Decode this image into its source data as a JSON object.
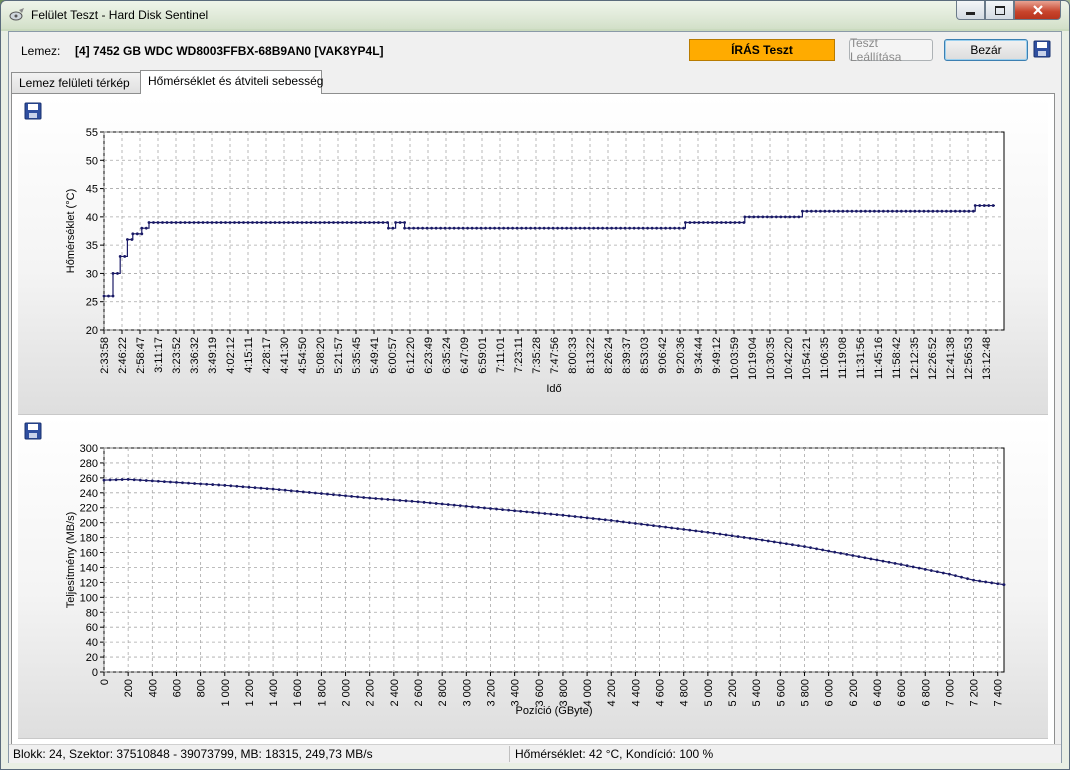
{
  "window": {
    "title": "Felület Teszt - Hard Disk Sentinel",
    "caption_buttons": [
      "minimize-icon",
      "maximize-icon",
      "close-icon"
    ]
  },
  "header": {
    "disk_label": "Lemez:",
    "disk_name": "[4] 7452 GB  WDC WD8003FFBX-68B9AN0 [VAK8YP4L]",
    "status_badge": "ÍRÁS Teszt",
    "stop_button": "Teszt Leállítása",
    "close_button": "Bezár",
    "accent_color": "#ffab00"
  },
  "tabs": [
    {
      "label": "Lemez felületi térkép"
    },
    {
      "label": "Hőmérséklet és átviteli sebesség"
    }
  ],
  "status_bar": {
    "left": "Blokk: 24, Szektor: 37510848 - 39073799, MB: 18315, 249,73 MB/s",
    "right": "Hőmérséklet: 42  °C,  Kondíció: 100 %"
  },
  "chart_data": [
    {
      "type": "line",
      "ylabel": "Hőmérséklet (°C)",
      "xlabel": "Idő",
      "ylim": [
        20,
        55
      ],
      "yticks": [
        20,
        25,
        30,
        35,
        40,
        45,
        50,
        55
      ],
      "grid": true,
      "categories": [
        "2:33:58",
        "2:46:22",
        "2:58:47",
        "3:11:17",
        "3:23:52",
        "3:36:32",
        "3:49:19",
        "4:02:12",
        "4:15:11",
        "4:28:17",
        "4:41:30",
        "4:54:50",
        "5:08:20",
        "5:21:57",
        "5:35:45",
        "5:49:41",
        "6:00:57",
        "6:12:20",
        "6:23:49",
        "6:35:24",
        "6:47:09",
        "6:59:01",
        "7:11:01",
        "7:23:11",
        "7:35:28",
        "7:47:56",
        "8:00:33",
        "8:13:22",
        "8:26:24",
        "8:39:37",
        "8:53:03",
        "9:06:42",
        "9:20:36",
        "9:34:44",
        "9:49:12",
        "10:03:59",
        "10:19:04",
        "10:30:35",
        "10:42:20",
        "10:54:21",
        "11:06:35",
        "11:19:08",
        "11:31:56",
        "11:45:16",
        "11:58:42",
        "12:12:35",
        "12:26:52",
        "12:41:38",
        "12:56:53",
        "13:12:48"
      ],
      "steps": [
        {
          "from": 0.0,
          "to": 0.5,
          "value": 26
        },
        {
          "from": 0.5,
          "to": 0.9,
          "value": 30
        },
        {
          "from": 0.9,
          "to": 1.3,
          "value": 33
        },
        {
          "from": 1.3,
          "to": 1.6,
          "value": 36
        },
        {
          "from": 1.6,
          "to": 2.1,
          "value": 37
        },
        {
          "from": 2.1,
          "to": 2.5,
          "value": 38
        },
        {
          "from": 2.5,
          "to": 15.8,
          "value": 39
        },
        {
          "from": 15.8,
          "to": 16.2,
          "value": 38
        },
        {
          "from": 16.2,
          "to": 16.7,
          "value": 39
        },
        {
          "from": 16.7,
          "to": 32.3,
          "value": 38
        },
        {
          "from": 32.3,
          "to": 35.6,
          "value": 39
        },
        {
          "from": 35.6,
          "to": 38.8,
          "value": 40
        },
        {
          "from": 38.8,
          "to": 48.4,
          "value": 41
        },
        {
          "from": 48.4,
          "to": 49.5,
          "value": 42
        }
      ]
    },
    {
      "type": "line",
      "ylabel": "Teljesítmény (MB/s)",
      "xlabel": "Pozíció (GByte)",
      "xlim": [
        0,
        7452
      ],
      "ylim": [
        0,
        300
      ],
      "yticks": [
        0,
        20,
        40,
        60,
        80,
        100,
        120,
        140,
        160,
        180,
        200,
        220,
        240,
        260,
        280,
        300
      ],
      "xticks": [
        "0",
        "200",
        "400",
        "600",
        "800",
        "1 000",
        "1 200",
        "1 400",
        "1 600",
        "1 800",
        "2 000",
        "2 200",
        "2 400",
        "2 600",
        "2 800",
        "3 000",
        "3 200",
        "3 400",
        "3 600",
        "3 800",
        "4 000",
        "4 200",
        "4 400",
        "4 600",
        "4 800",
        "5 000",
        "5 200",
        "5 400",
        "5 600",
        "5 800",
        "6 000",
        "6 200",
        "6 400",
        "6 600",
        "6 800",
        "7 000",
        "7 200",
        "7 400"
      ],
      "grid": true,
      "x": [
        0,
        200,
        400,
        600,
        800,
        1000,
        1400,
        1800,
        2200,
        2600,
        3000,
        3400,
        3800,
        4200,
        4600,
        5000,
        5400,
        5800,
        6200,
        6600,
        7000,
        7200,
        7452
      ],
      "values": [
        257,
        258,
        256,
        254,
        252,
        250,
        245,
        239,
        233,
        228,
        222,
        216,
        210,
        203,
        195,
        187,
        178,
        168,
        156,
        144,
        131,
        123,
        117
      ]
    }
  ]
}
